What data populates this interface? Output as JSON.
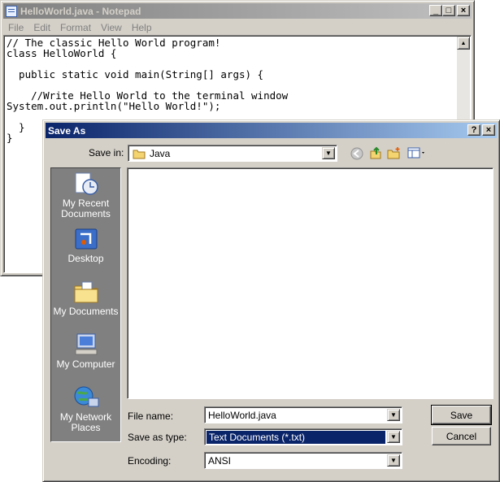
{
  "notepad": {
    "title": "HelloWorld.java - Notepad",
    "menu": [
      "File",
      "Edit",
      "Format",
      "View",
      "Help"
    ],
    "content": "// The classic Hello World program!\nclass HelloWorld {\n\n  public static void main(String[] args) {\n\n    //Write Hello World to the terminal window\nSystem.out.println(\"Hello World!\");\n\n  }\n}",
    "window_buttons": {
      "minimize": "_",
      "maximize": "□",
      "close": "×"
    }
  },
  "save_as": {
    "title": "Save As",
    "help_glyph": "?",
    "close_glyph": "×",
    "save_in_label": "Save in:",
    "save_in_value": "Java",
    "places": [
      {
        "label": "My Recent Documents",
        "icon": "recent-documents-icon"
      },
      {
        "label": "Desktop",
        "icon": "desktop-icon"
      },
      {
        "label": "My Documents",
        "icon": "my-documents-icon"
      },
      {
        "label": "My Computer",
        "icon": "my-computer-icon"
      },
      {
        "label": "My Network Places",
        "icon": "network-places-icon"
      }
    ],
    "file_name_label": "File name:",
    "file_name_value": "HelloWorld.java",
    "save_as_type_label": "Save as type:",
    "save_as_type_value": "Text Documents (*.txt)",
    "encoding_label": "Encoding:",
    "encoding_value": "ANSI",
    "save_button": "Save",
    "cancel_button": "Cancel",
    "colors": {
      "title_active": "#0a246a",
      "title_inactive": "#808080",
      "face": "#d4d0c8"
    }
  }
}
